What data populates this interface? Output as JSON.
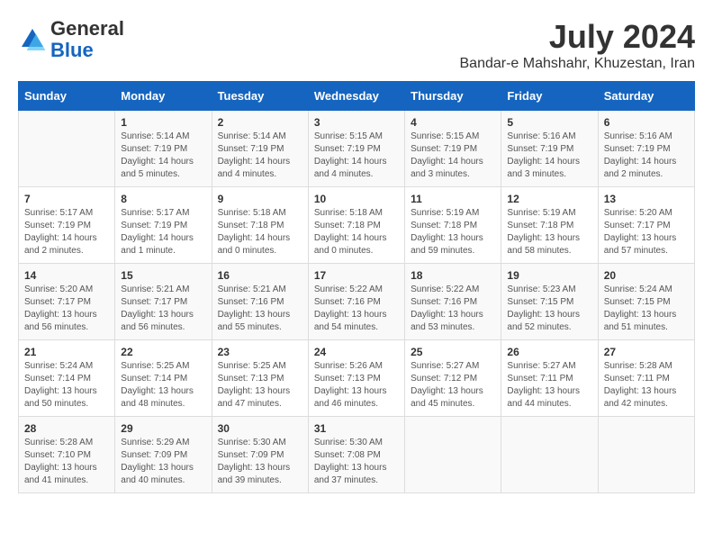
{
  "header": {
    "logo_general": "General",
    "logo_blue": "Blue",
    "month_year": "July 2024",
    "location": "Bandar-e Mahshahr, Khuzestan, Iran"
  },
  "weekdays": [
    "Sunday",
    "Monday",
    "Tuesday",
    "Wednesday",
    "Thursday",
    "Friday",
    "Saturday"
  ],
  "weeks": [
    [
      {
        "day": "",
        "content": ""
      },
      {
        "day": "1",
        "content": "Sunrise: 5:14 AM\nSunset: 7:19 PM\nDaylight: 14 hours\nand 5 minutes."
      },
      {
        "day": "2",
        "content": "Sunrise: 5:14 AM\nSunset: 7:19 PM\nDaylight: 14 hours\nand 4 minutes."
      },
      {
        "day": "3",
        "content": "Sunrise: 5:15 AM\nSunset: 7:19 PM\nDaylight: 14 hours\nand 4 minutes."
      },
      {
        "day": "4",
        "content": "Sunrise: 5:15 AM\nSunset: 7:19 PM\nDaylight: 14 hours\nand 3 minutes."
      },
      {
        "day": "5",
        "content": "Sunrise: 5:16 AM\nSunset: 7:19 PM\nDaylight: 14 hours\nand 3 minutes."
      },
      {
        "day": "6",
        "content": "Sunrise: 5:16 AM\nSunset: 7:19 PM\nDaylight: 14 hours\nand 2 minutes."
      }
    ],
    [
      {
        "day": "7",
        "content": "Sunrise: 5:17 AM\nSunset: 7:19 PM\nDaylight: 14 hours\nand 2 minutes."
      },
      {
        "day": "8",
        "content": "Sunrise: 5:17 AM\nSunset: 7:19 PM\nDaylight: 14 hours\nand 1 minute."
      },
      {
        "day": "9",
        "content": "Sunrise: 5:18 AM\nSunset: 7:18 PM\nDaylight: 14 hours\nand 0 minutes."
      },
      {
        "day": "10",
        "content": "Sunrise: 5:18 AM\nSunset: 7:18 PM\nDaylight: 14 hours\nand 0 minutes."
      },
      {
        "day": "11",
        "content": "Sunrise: 5:19 AM\nSunset: 7:18 PM\nDaylight: 13 hours\nand 59 minutes."
      },
      {
        "day": "12",
        "content": "Sunrise: 5:19 AM\nSunset: 7:18 PM\nDaylight: 13 hours\nand 58 minutes."
      },
      {
        "day": "13",
        "content": "Sunrise: 5:20 AM\nSunset: 7:17 PM\nDaylight: 13 hours\nand 57 minutes."
      }
    ],
    [
      {
        "day": "14",
        "content": "Sunrise: 5:20 AM\nSunset: 7:17 PM\nDaylight: 13 hours\nand 56 minutes."
      },
      {
        "day": "15",
        "content": "Sunrise: 5:21 AM\nSunset: 7:17 PM\nDaylight: 13 hours\nand 56 minutes."
      },
      {
        "day": "16",
        "content": "Sunrise: 5:21 AM\nSunset: 7:16 PM\nDaylight: 13 hours\nand 55 minutes."
      },
      {
        "day": "17",
        "content": "Sunrise: 5:22 AM\nSunset: 7:16 PM\nDaylight: 13 hours\nand 54 minutes."
      },
      {
        "day": "18",
        "content": "Sunrise: 5:22 AM\nSunset: 7:16 PM\nDaylight: 13 hours\nand 53 minutes."
      },
      {
        "day": "19",
        "content": "Sunrise: 5:23 AM\nSunset: 7:15 PM\nDaylight: 13 hours\nand 52 minutes."
      },
      {
        "day": "20",
        "content": "Sunrise: 5:24 AM\nSunset: 7:15 PM\nDaylight: 13 hours\nand 51 minutes."
      }
    ],
    [
      {
        "day": "21",
        "content": "Sunrise: 5:24 AM\nSunset: 7:14 PM\nDaylight: 13 hours\nand 50 minutes."
      },
      {
        "day": "22",
        "content": "Sunrise: 5:25 AM\nSunset: 7:14 PM\nDaylight: 13 hours\nand 48 minutes."
      },
      {
        "day": "23",
        "content": "Sunrise: 5:25 AM\nSunset: 7:13 PM\nDaylight: 13 hours\nand 47 minutes."
      },
      {
        "day": "24",
        "content": "Sunrise: 5:26 AM\nSunset: 7:13 PM\nDaylight: 13 hours\nand 46 minutes."
      },
      {
        "day": "25",
        "content": "Sunrise: 5:27 AM\nSunset: 7:12 PM\nDaylight: 13 hours\nand 45 minutes."
      },
      {
        "day": "26",
        "content": "Sunrise: 5:27 AM\nSunset: 7:11 PM\nDaylight: 13 hours\nand 44 minutes."
      },
      {
        "day": "27",
        "content": "Sunrise: 5:28 AM\nSunset: 7:11 PM\nDaylight: 13 hours\nand 42 minutes."
      }
    ],
    [
      {
        "day": "28",
        "content": "Sunrise: 5:28 AM\nSunset: 7:10 PM\nDaylight: 13 hours\nand 41 minutes."
      },
      {
        "day": "29",
        "content": "Sunrise: 5:29 AM\nSunset: 7:09 PM\nDaylight: 13 hours\nand 40 minutes."
      },
      {
        "day": "30",
        "content": "Sunrise: 5:30 AM\nSunset: 7:09 PM\nDaylight: 13 hours\nand 39 minutes."
      },
      {
        "day": "31",
        "content": "Sunrise: 5:30 AM\nSunset: 7:08 PM\nDaylight: 13 hours\nand 37 minutes."
      },
      {
        "day": "",
        "content": ""
      },
      {
        "day": "",
        "content": ""
      },
      {
        "day": "",
        "content": ""
      }
    ]
  ]
}
